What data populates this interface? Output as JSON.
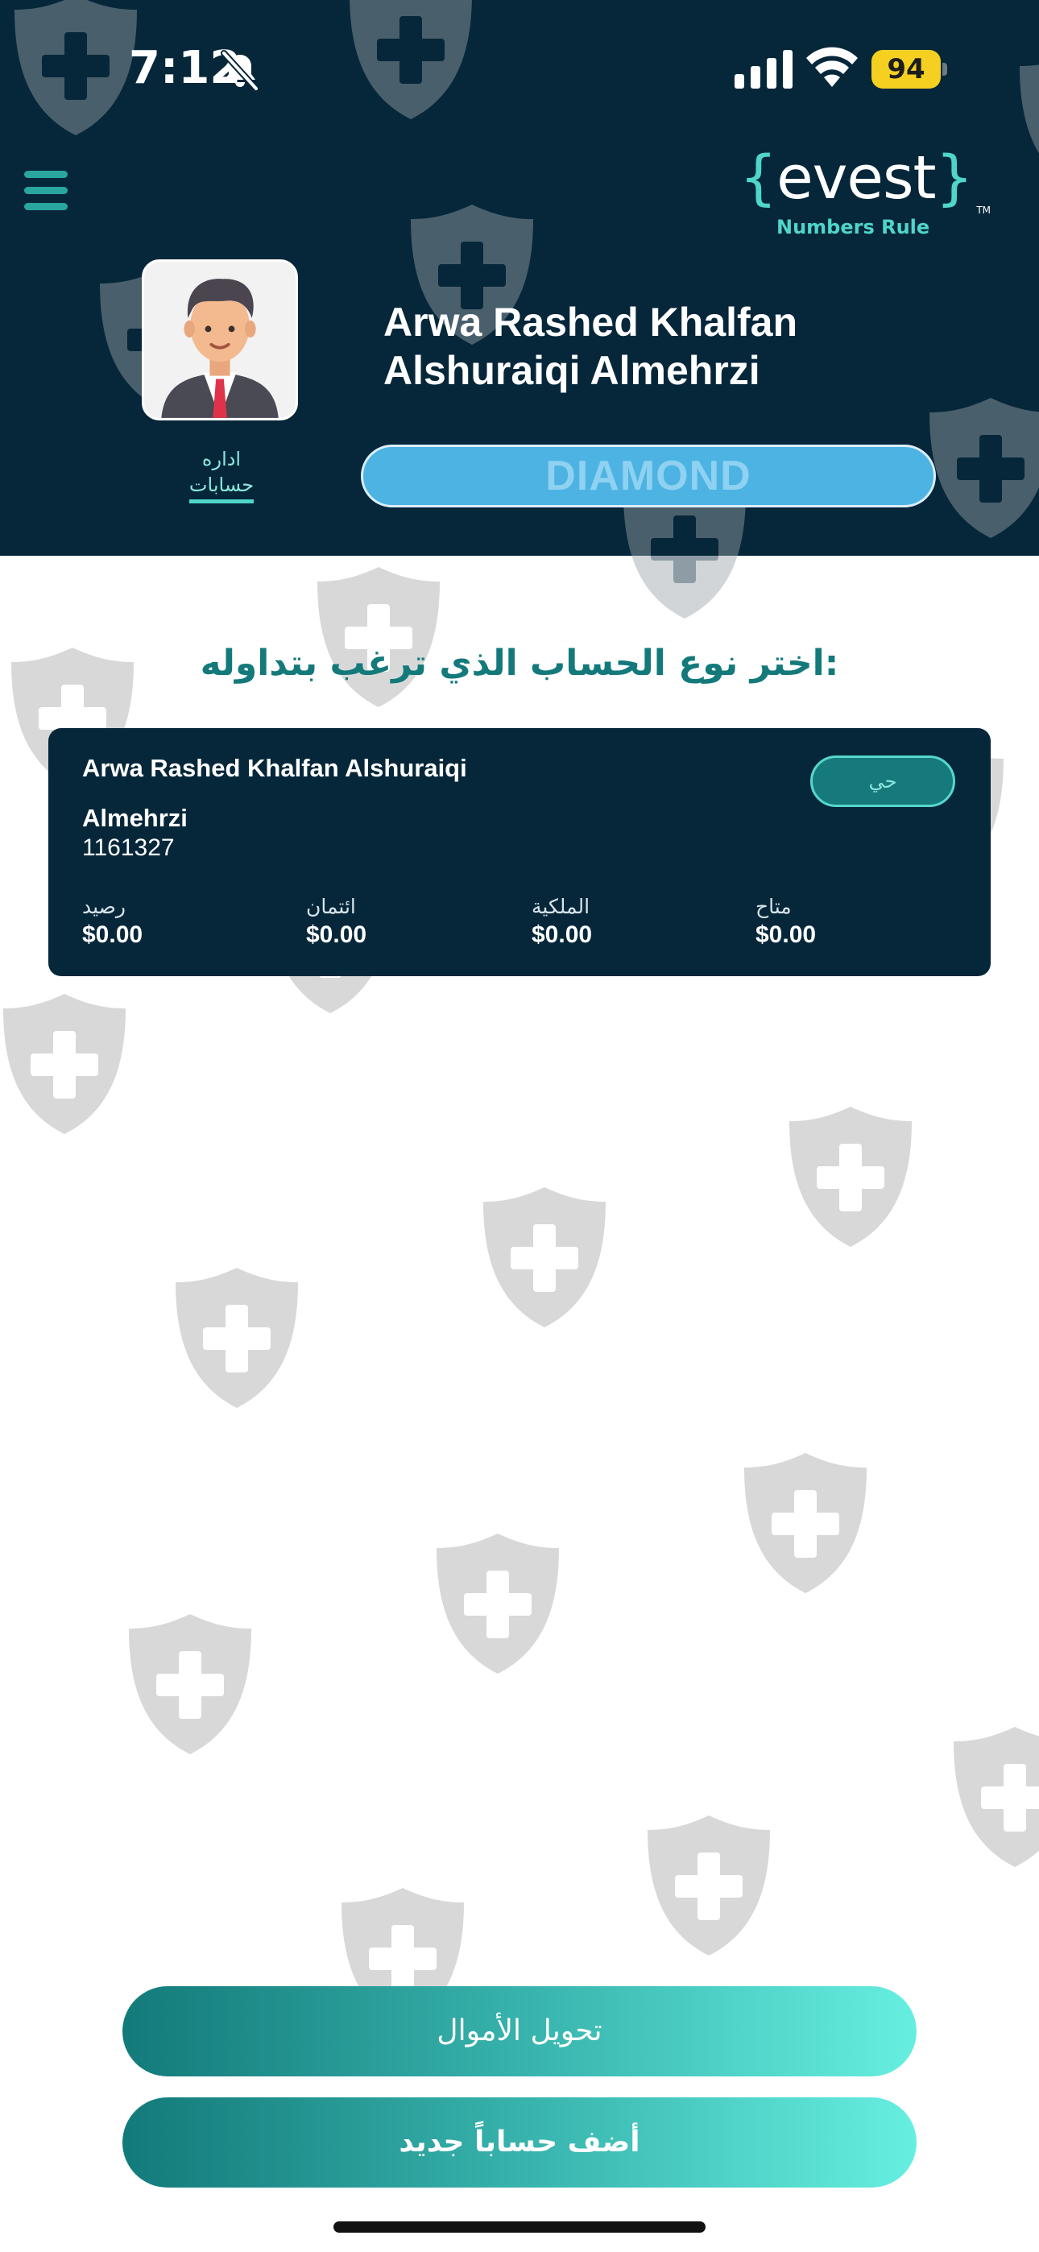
{
  "status_bar": {
    "time": "7:12",
    "battery": "94"
  },
  "brand": {
    "logo_open": "{",
    "logo_word": "evest",
    "logo_close": "}",
    "tagline": "Numbers Rule",
    "trademark": "TM",
    "accent_color": "#4fd6c8",
    "header_color": "#06273a"
  },
  "profile": {
    "name": "Arwa Rashed Khalfan Alshuraiqi Almehrzi",
    "manage_accounts_line1": "اداره",
    "manage_accounts_line2": "حسابات",
    "tier": "DIAMOND"
  },
  "main": {
    "section_title": ":اختر نوع الحساب الذي ترغب بتداوله"
  },
  "account_card": {
    "name_line1": "Arwa Rashed Khalfan Alshuraiqi",
    "name_line2": "Almehrzi",
    "account_number": "1161327",
    "status": "حي",
    "stats": [
      {
        "label": "رصيد",
        "value": "$0.00"
      },
      {
        "label": "ائتمان",
        "value": "$0.00"
      },
      {
        "label": "الملكية",
        "value": "$0.00"
      },
      {
        "label": "متاح",
        "value": "$0.00"
      }
    ]
  },
  "buttons": {
    "transfer_funds": "تحويل الأموال",
    "add_account": "أضف حساباً جديد"
  },
  "icons": [
    "bell-slash-icon",
    "signal-icon",
    "wifi-icon",
    "battery-icon",
    "hamburger-menu-icon",
    "avatar-illustration",
    "shield-watermark-icon"
  ]
}
